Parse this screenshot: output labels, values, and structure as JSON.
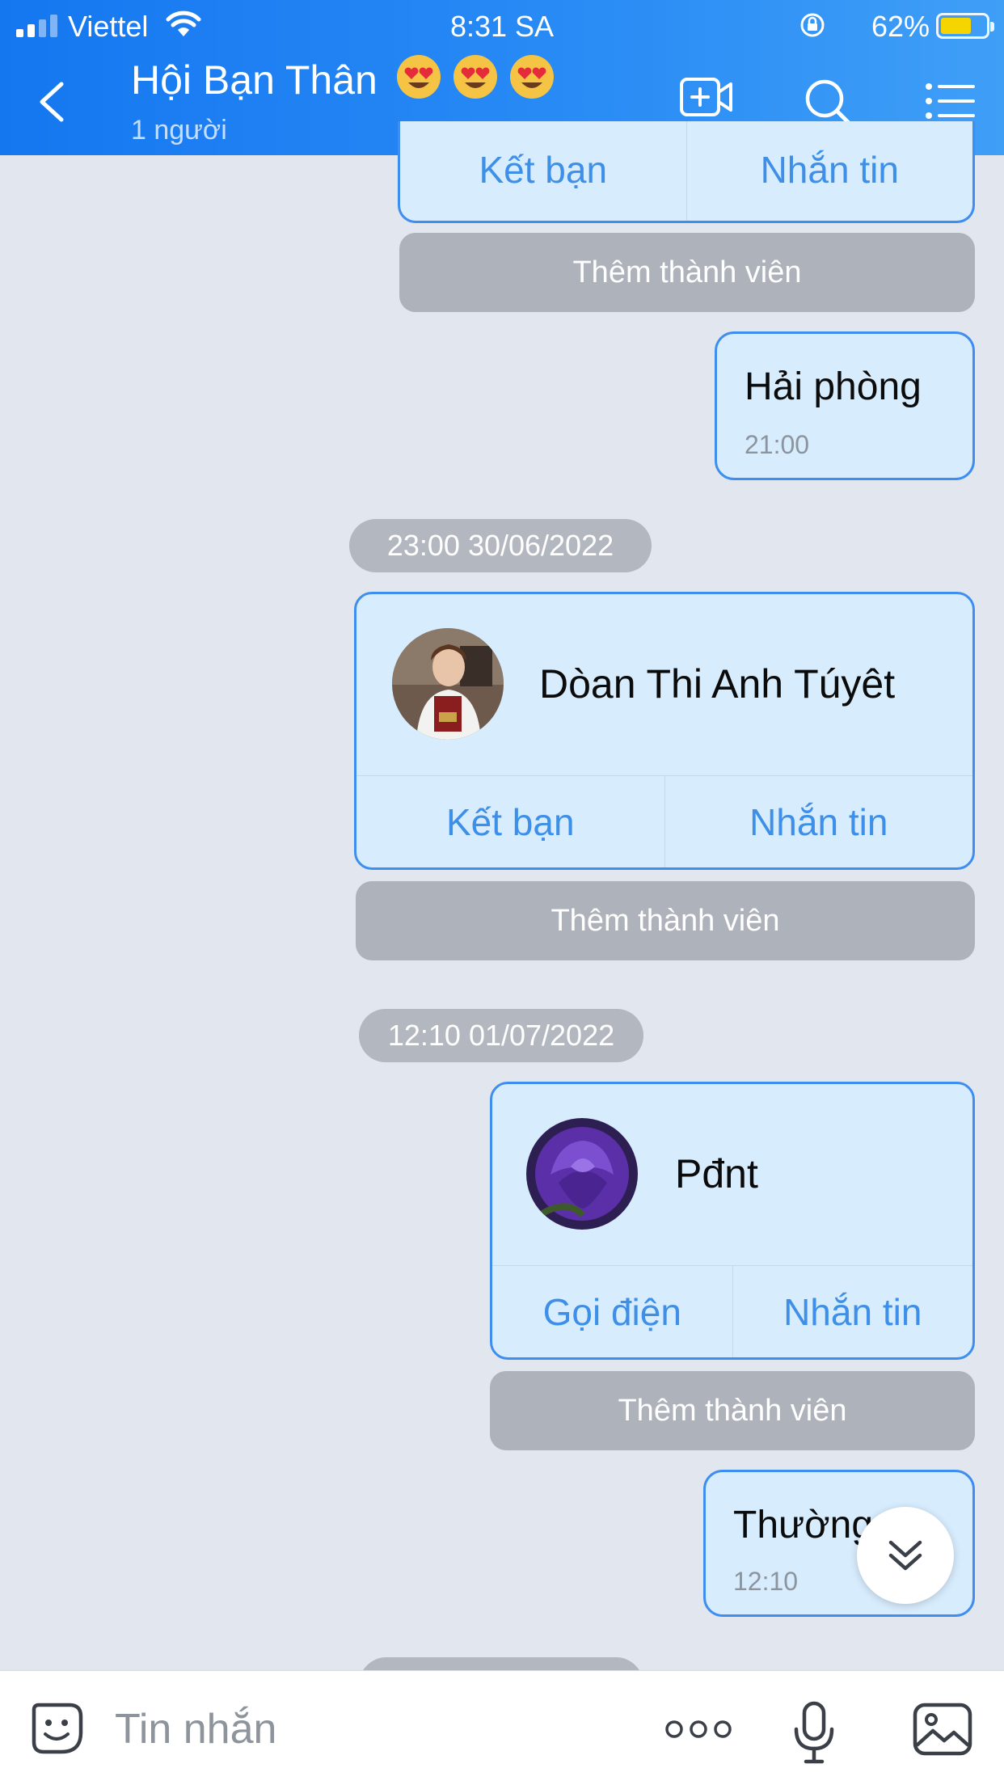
{
  "status_bar": {
    "carrier": "Viettel",
    "time": "8:31 SA",
    "battery": "62%",
    "battery_level": 0.62,
    "signal_bars_active": 2
  },
  "header": {
    "title": "Hội Bạn Thân",
    "title_emojis": [
      "heart-eyes-emoji",
      "heart-eyes-emoji",
      "heart-eyes-emoji"
    ],
    "subtitle": "1 người",
    "icons": [
      "back-icon",
      "video-call-icon",
      "search-icon",
      "menu-icon"
    ]
  },
  "messages": {
    "card_top": {
      "add_friend": "Kết bạn",
      "message": "Nhắn tin",
      "add_member": "Thêm thành viên"
    },
    "bubble1": {
      "text": "Hải phòng",
      "time": "21:00"
    },
    "date1": "23:00 30/06/2022",
    "card1": {
      "name": "Dòan Thi Anh Túyêt",
      "add_friend": "Kết bạn",
      "message": "Nhắn tin",
      "add_member": "Thêm thành viên"
    },
    "date2": "12:10 01/07/2022",
    "card2": {
      "name": "Pđnt",
      "call": "Gọi điện",
      "message": "Nhắn tin",
      "add_member": "Thêm thành viên"
    },
    "bubble2": {
      "text": "Thường",
      "time": "12:10"
    }
  },
  "input_bar": {
    "placeholder": "Tin nhắn",
    "icons": [
      "sticker-icon",
      "more-icon",
      "microphone-icon",
      "image-icon"
    ]
  },
  "colors": {
    "header_blue": "#1e82f3",
    "bubble_bg": "#d7ecfd",
    "bubble_border": "#3e8ef0",
    "action_text": "#3d8fe8",
    "gray_button": "#aeb2ba",
    "chat_bg": "#e2e7ef"
  }
}
